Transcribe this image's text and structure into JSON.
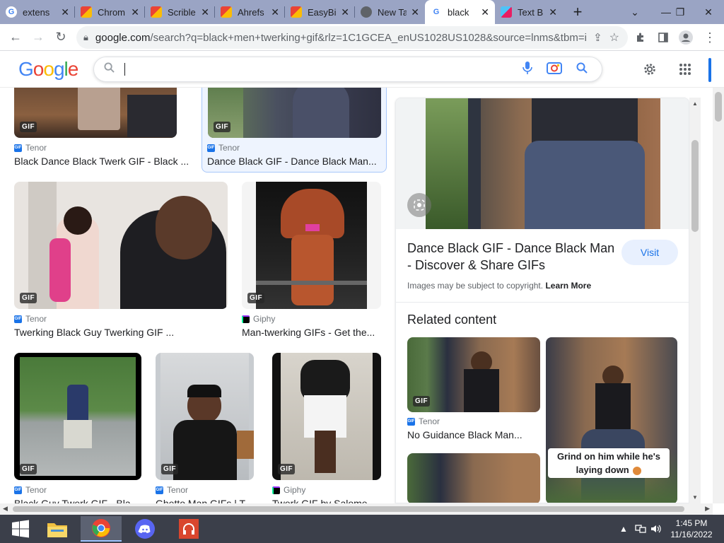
{
  "tabs": [
    {
      "label": "extens",
      "icon": "google-icon",
      "active": false
    },
    {
      "label": "Chrom",
      "icon": "store-icon",
      "active": false
    },
    {
      "label": "Scrible",
      "icon": "store-icon",
      "active": false
    },
    {
      "label": "Ahrefs",
      "icon": "store-icon",
      "active": false
    },
    {
      "label": "EasyBi",
      "icon": "store-icon",
      "active": false
    },
    {
      "label": "New Ta",
      "icon": "chrome-icon",
      "active": false
    },
    {
      "label": "black",
      "icon": "google-icon",
      "active": true
    },
    {
      "label": "Text B",
      "icon": "extension-icon",
      "active": false
    }
  ],
  "new_tab_label": "+",
  "address": {
    "domain": "google.com",
    "path": "/search?q=black+men+twerking+gif&rlz=1C1GCEA_enUS1028US1028&source=lnms&tbm=isc..."
  },
  "google": {
    "logo": [
      "G",
      "o",
      "o",
      "g",
      "l",
      "e"
    ],
    "logo_colors": [
      "#4285f4",
      "#ea4335",
      "#fbbc05",
      "#4285f4",
      "#34a853",
      "#ea4335"
    ],
    "search_value": ""
  },
  "results": [
    {
      "source": "Tenor",
      "source_type": "tenor",
      "title": "Black Dance Black Twerk GIF - Black ...",
      "badge": "GIF"
    },
    {
      "source": "Tenor",
      "source_type": "tenor",
      "title": "Dance Black GIF - Dance Black Man...",
      "badge": "GIF",
      "selected": true
    },
    {
      "source": "Tenor",
      "source_type": "tenor",
      "title": "Twerking Black Guy Twerking GIF ...",
      "badge": "GIF"
    },
    {
      "source": "Giphy",
      "source_type": "giphy",
      "title": "Man-twerking GIFs - Get the...",
      "badge": "GIF"
    },
    {
      "source": "Tenor",
      "source_type": "tenor",
      "title": "Black Guy Twerk GIF - Bla...",
      "badge": "GIF"
    },
    {
      "source": "Tenor",
      "source_type": "tenor",
      "title": "Ghetto Man GIFs | T...",
      "badge": "GIF"
    },
    {
      "source": "Giphy",
      "source_type": "giphy",
      "title": "Twerk GIF by Salome...",
      "badge": "GIF"
    }
  ],
  "panel": {
    "title": "Dance Black GIF - Dance Black Man - Discover & Share GIFs",
    "visit_label": "Visit",
    "copyright_text": "Images may be subject to copyright.",
    "learn_more": "Learn More",
    "related_heading": "Related content",
    "related": [
      {
        "source": "Tenor",
        "title": "No Guidance Black Man...",
        "badge": "GIF"
      },
      {
        "caption_line1": "Grind on him while he's",
        "caption_line2": "laying down"
      }
    ]
  },
  "taskbar": {
    "time": "1:45 PM",
    "date": "11/16/2022"
  },
  "colors": {
    "tabstrip": "#9aa4c4",
    "accent": "#1a73e8",
    "taskbar": "#3b3f4a"
  }
}
